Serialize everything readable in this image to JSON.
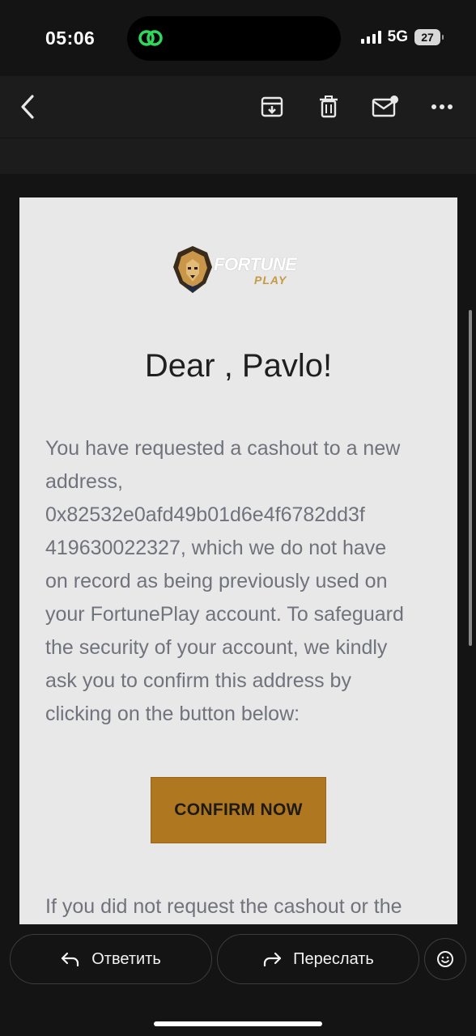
{
  "status": {
    "time": "05:06",
    "network": "5G",
    "battery": "27"
  },
  "toolbar": {
    "back_icon": "chevron-left-icon",
    "archive_icon": "archive-icon",
    "delete_icon": "trash-icon",
    "unread_icon": "mail-unread-icon",
    "more_icon": "more-horizontal-icon"
  },
  "email": {
    "logo": {
      "line1": "FORTUNE",
      "line2": "PLAY"
    },
    "greeting": "Dear , Pavlo!",
    "body_lines": [
      "You have requested a cashout to a new",
      "address,",
      "0x82532e0afd49b01d6e4f6782dd3f",
      "419630022327, which we do not have",
      "on record as being previously used on",
      "your FortunePlay account. To safeguard",
      "the security of your account, we kindly",
      "ask you to confirm this address by",
      "clicking on the button below:"
    ],
    "cta_label": "CONFIRM NOW",
    "footer_line": "If you did not request the cashout or the",
    "colors": {
      "cta": "#b07721",
      "card": "#e8e8e8",
      "text": "#70737c"
    }
  },
  "actions": {
    "reply_label": "Ответить",
    "forward_label": "Переслать",
    "emoji_icon": "smiley-icon"
  }
}
